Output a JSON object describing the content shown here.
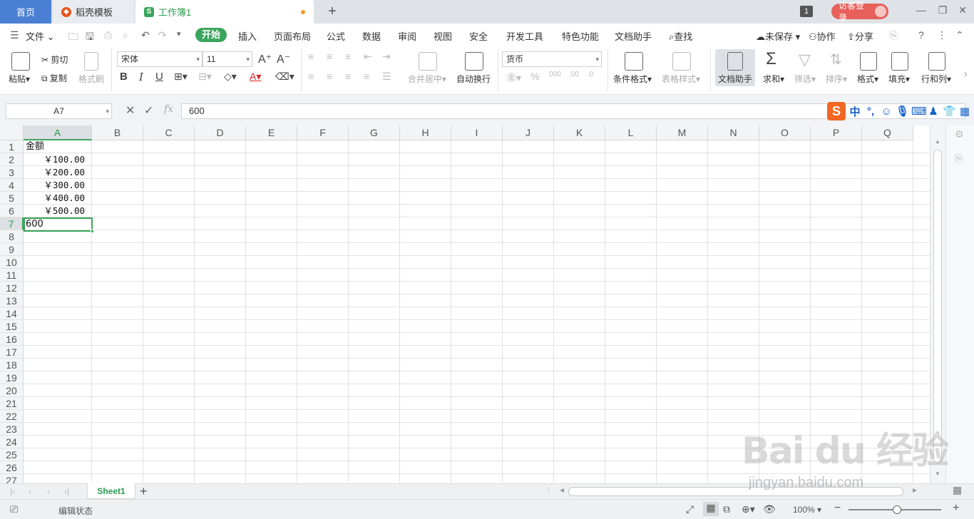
{
  "tabs": {
    "home": "首页",
    "template": "稻壳模板",
    "workbook": "工作簿1",
    "window_count": "1",
    "login": "访客登录"
  },
  "menu": {
    "file": "文件",
    "items": [
      "开始",
      "插入",
      "页面布局",
      "公式",
      "数据",
      "审阅",
      "视图",
      "安全",
      "开发工具",
      "特色功能",
      "文档助手"
    ],
    "search": "查找",
    "unsaved": "未保存",
    "collab": "协作",
    "share": "分享"
  },
  "ribbon": {
    "paste": "粘贴",
    "cut": "剪切",
    "copy": "复制",
    "format_painter": "格式刷",
    "font_name": "宋体",
    "font_size": "11",
    "merge_center": "合并居中",
    "wrap_text": "自动换行",
    "number_format": "货币",
    "conditional_format": "条件格式",
    "table_style": "表格样式",
    "doc_assistant": "文档助手",
    "sum": "求和",
    "filter": "筛选",
    "sort": "排序",
    "format": "格式",
    "fill": "填充",
    "row_col": "行和列"
  },
  "formula_bar": {
    "cell_ref": "A7",
    "fx": "fx",
    "content": "600"
  },
  "grid": {
    "columns": [
      "A",
      "B",
      "C",
      "D",
      "E",
      "F",
      "G",
      "H",
      "I",
      "J",
      "K",
      "L",
      "M",
      "N",
      "O",
      "P",
      "Q"
    ],
    "rows": [
      "1",
      "2",
      "3",
      "4",
      "5",
      "6",
      "7",
      "8",
      "9",
      "10",
      "11",
      "12",
      "13",
      "14",
      "15",
      "16",
      "17",
      "18",
      "19",
      "20",
      "21",
      "22",
      "23",
      "24",
      "25",
      "26",
      "27"
    ],
    "cells": {
      "A1": "金额",
      "A2": "￥100.00",
      "A3": "￥200.00",
      "A4": "￥300.00",
      "A5": "￥400.00",
      "A6": "￥500.00",
      "A7": "600"
    },
    "selected_cell": "A7"
  },
  "sheets": {
    "active": "Sheet1"
  },
  "status": {
    "mode": "编辑状态",
    "zoom": "100%"
  },
  "watermark": {
    "brand": "Bai du 经验",
    "url": "jingyan.baidu.com"
  },
  "colors": {
    "accent_green": "#3aa55c",
    "home_tab_blue": "#4a7fd4",
    "login_red": "#e8605a"
  }
}
